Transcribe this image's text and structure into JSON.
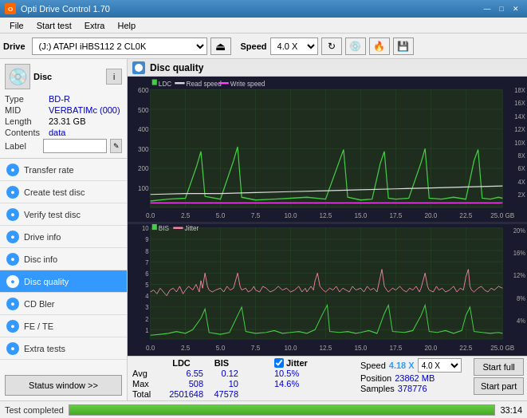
{
  "titleBar": {
    "title": "Opti Drive Control 1.70",
    "minimize": "—",
    "maximize": "□",
    "close": "✕"
  },
  "menu": {
    "items": [
      "File",
      "Start test",
      "Extra",
      "Help"
    ]
  },
  "toolbar": {
    "driveLabel": "Drive",
    "driveValue": "(J:)  ATAPI iHBS112  2 CL0K",
    "speedLabel": "Speed",
    "speedValue": "4.0 X"
  },
  "disc": {
    "header": "Disc",
    "typeLabel": "Type",
    "typeValue": "BD-R",
    "midLabel": "MID",
    "midValue": "VERBATIMc (000)",
    "lengthLabel": "Length",
    "lengthValue": "23.31 GB",
    "contentsLabel": "Contents",
    "contentsValue": "data",
    "labelLabel": "Label"
  },
  "nav": {
    "items": [
      {
        "label": "Transfer rate",
        "active": false
      },
      {
        "label": "Create test disc",
        "active": false
      },
      {
        "label": "Verify test disc",
        "active": false
      },
      {
        "label": "Drive info",
        "active": false
      },
      {
        "label": "Disc info",
        "active": false
      },
      {
        "label": "Disc quality",
        "active": true
      },
      {
        "label": "CD Bler",
        "active": false
      },
      {
        "label": "FE / TE",
        "active": false
      },
      {
        "label": "Extra tests",
        "active": false
      }
    ],
    "statusBtn": "Status window >>"
  },
  "chart": {
    "title": "Disc quality",
    "legend1": [
      "LDC",
      "Read speed",
      "Write speed"
    ],
    "legend2": [
      "BIS",
      "Jitter"
    ],
    "xLabels": [
      "0.0",
      "2.5",
      "5.0",
      "7.5",
      "10.0",
      "12.5",
      "15.0",
      "17.5",
      "20.0",
      "22.5",
      "25.0"
    ],
    "yLeft1": [
      "600",
      "500",
      "400",
      "300",
      "200",
      "100"
    ],
    "yRight1": [
      "18X",
      "16X",
      "14X",
      "12X",
      "10X",
      "8X",
      "6X",
      "4X",
      "2X"
    ],
    "yLeft2": [
      "10",
      "9",
      "8",
      "7",
      "6",
      "5",
      "4",
      "3",
      "2",
      "1"
    ],
    "yRight2": [
      "20%",
      "16%",
      "12%",
      "8%",
      "4%"
    ]
  },
  "stats": {
    "ldcLabel": "LDC",
    "bisLabel": "BIS",
    "jitterLabel": "Jitter",
    "speedLabel": "Speed",
    "positionLabel": "Position",
    "samplesLabel": "Samples",
    "avgLabel": "Avg",
    "maxLabel": "Max",
    "totalLabel": "Total",
    "avgLDC": "6.55",
    "avgBIS": "0.12",
    "avgJitter": "10.5%",
    "maxLDC": "508",
    "maxBIS": "10",
    "maxJitter": "14.6%",
    "totalLDC": "2501648",
    "totalBIS": "47578",
    "speedCurrent": "4.18 X",
    "speedSelect": "4.0 X",
    "position": "23862 MB",
    "samples": "378776",
    "startFull": "Start full",
    "startPart": "Start part",
    "jitterChecked": true
  },
  "statusBar": {
    "text": "Test completed",
    "progress": 100,
    "time": "33:14"
  }
}
